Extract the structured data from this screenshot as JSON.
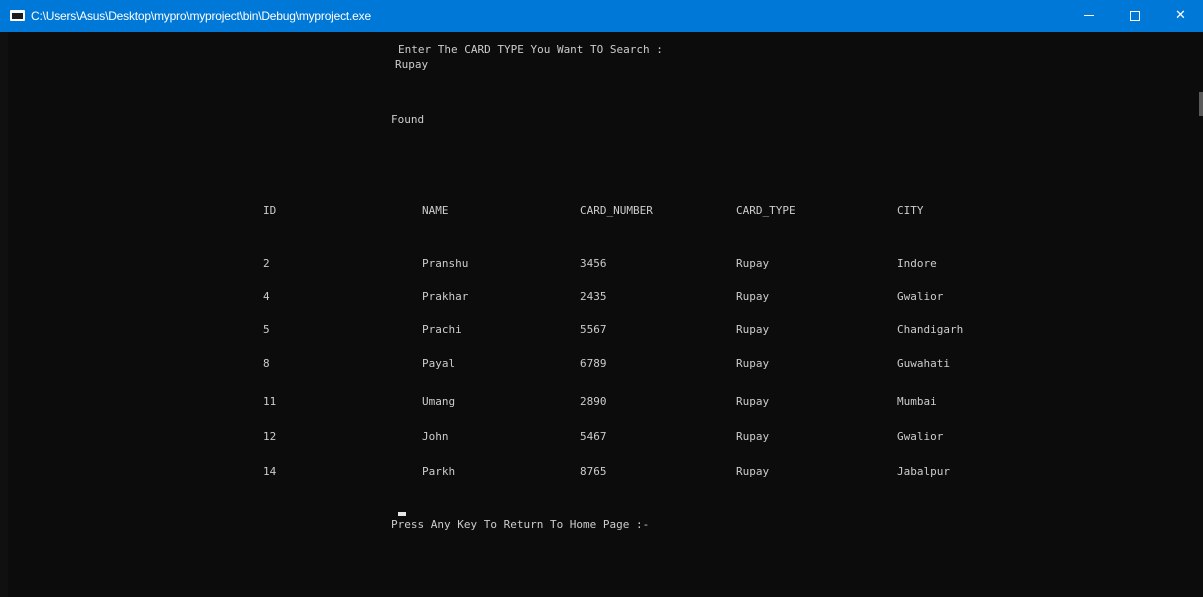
{
  "window": {
    "title": "C:\\Users\\Asus\\Desktop\\mypro\\myproject\\bin\\Debug\\myproject.exe",
    "controls": {
      "minimize_icon": "minimize-icon",
      "maximize_icon": "maximize-icon",
      "close_icon": "close-icon",
      "close_glyph": "✕"
    }
  },
  "console": {
    "prompt": "Enter The CARD TYPE You Want TO Search :",
    "input_value": "Rupay",
    "status": "Found",
    "table": {
      "headers": [
        "ID",
        "NAME",
        "CARD_NUMBER",
        "CARD_TYPE",
        "CITY"
      ],
      "rows": [
        [
          "2",
          "Pranshu",
          "3456",
          "Rupay",
          "Indore"
        ],
        [
          "4",
          "Prakhar",
          "2435",
          "Rupay",
          "Gwalior"
        ],
        [
          "5",
          "Prachi",
          "5567",
          "Rupay",
          "Chandigarh"
        ],
        [
          "8",
          "Payal",
          "6789",
          "Rupay",
          "Guwahati"
        ],
        [
          "11",
          "Umang",
          "2890",
          "Rupay",
          "Mumbai"
        ],
        [
          "12",
          "John",
          "5467",
          "Rupay",
          "Gwalior"
        ],
        [
          "14",
          "Parkh",
          "8765",
          "Rupay",
          "Jabalpur"
        ]
      ]
    },
    "footer_prompt": "Press Any Key To Return To Home Page :-"
  },
  "colors": {
    "titlebar": "#0078d7",
    "background": "#0c0c0c",
    "text": "#cccccc"
  }
}
